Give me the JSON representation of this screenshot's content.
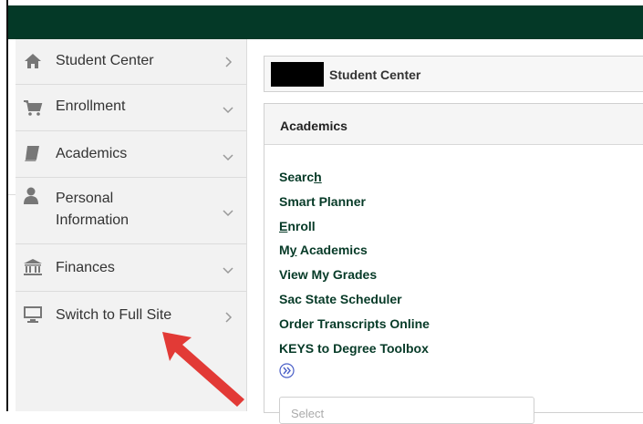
{
  "sidebar": {
    "items": [
      {
        "label": "Student Center",
        "icon": "home-icon"
      },
      {
        "label": "Enrollment",
        "icon": "cart-icon"
      },
      {
        "label": "Academics",
        "icon": "book-icon"
      },
      {
        "label": "Personal Information",
        "line1": "Personal",
        "line2": "Information",
        "icon": "person-icon"
      },
      {
        "label": "Finances",
        "icon": "bank-icon"
      },
      {
        "label": "Switch to Full Site",
        "icon": "monitor-icon"
      }
    ]
  },
  "header": {
    "title": "Student Center"
  },
  "academics": {
    "title": "Academics",
    "links": [
      {
        "pre": "Searc",
        "ul": "h",
        "post": ""
      },
      {
        "pre": "Smart Planner",
        "ul": "",
        "post": ""
      },
      {
        "pre": "",
        "ul": "E",
        "post": "nroll"
      },
      {
        "pre": "M",
        "ul": "y",
        "post": " Academics"
      },
      {
        "pre": "View My Grades",
        "ul": "",
        "post": ""
      },
      {
        "pre": "Sac State Scheduler",
        "ul": "",
        "post": ""
      },
      {
        "pre": "Order Transcripts Online",
        "ul": "",
        "post": ""
      },
      {
        "pre": "KEYS to Degree Toolbox",
        "ul": "",
        "post": ""
      }
    ],
    "select_placeholder": "Select"
  },
  "colors": {
    "topbar": "#043927",
    "link": "#063a27",
    "arrow": "#e23a36"
  }
}
